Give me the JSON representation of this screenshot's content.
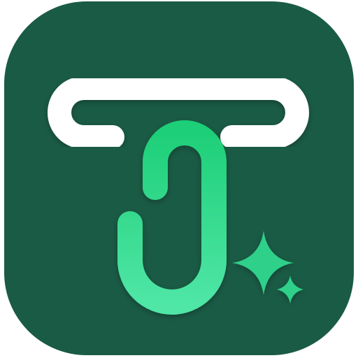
{
  "app_icon": {
    "icon_name": "paperclip-sparkle-app-icon",
    "colors": {
      "background": "#1a5b45",
      "crossbar": "#ffffff",
      "clip_top": "#1ecf78",
      "clip_bottom": "#4fe6a6",
      "sparkle": "#2fd08a"
    }
  }
}
